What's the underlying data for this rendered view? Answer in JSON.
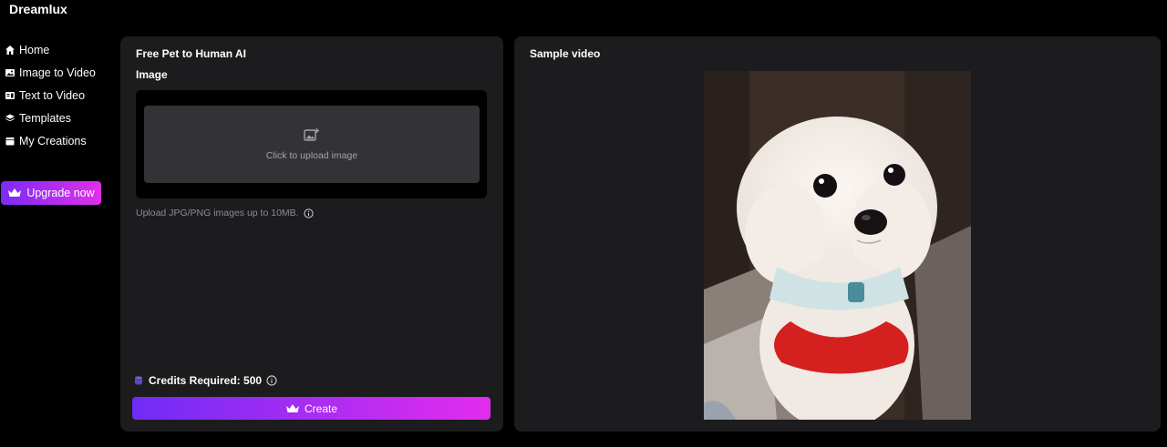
{
  "brand": "Dreamlux",
  "nav": [
    {
      "label": "Home",
      "icon": "home-icon"
    },
    {
      "label": "Image to Video",
      "icon": "image-icon"
    },
    {
      "label": "Text to Video",
      "icon": "text-video-icon"
    },
    {
      "label": "Templates",
      "icon": "layers-icon"
    },
    {
      "label": "My Creations",
      "icon": "folder-icon"
    }
  ],
  "upgrade_label": "Upgrade now",
  "left_panel": {
    "title": "Free Pet to Human AI",
    "image_label": "Image",
    "upload_text": "Click to upload image",
    "hint": "Upload JPG/PNG images up to 10MB.",
    "credits": "Credits Required: 500",
    "create_label": "Create"
  },
  "right_panel": {
    "title": "Sample video"
  },
  "colors": {
    "accent_start": "#7b2cf7",
    "accent_end": "#e22ee9",
    "panel": "#1c1c1e"
  }
}
